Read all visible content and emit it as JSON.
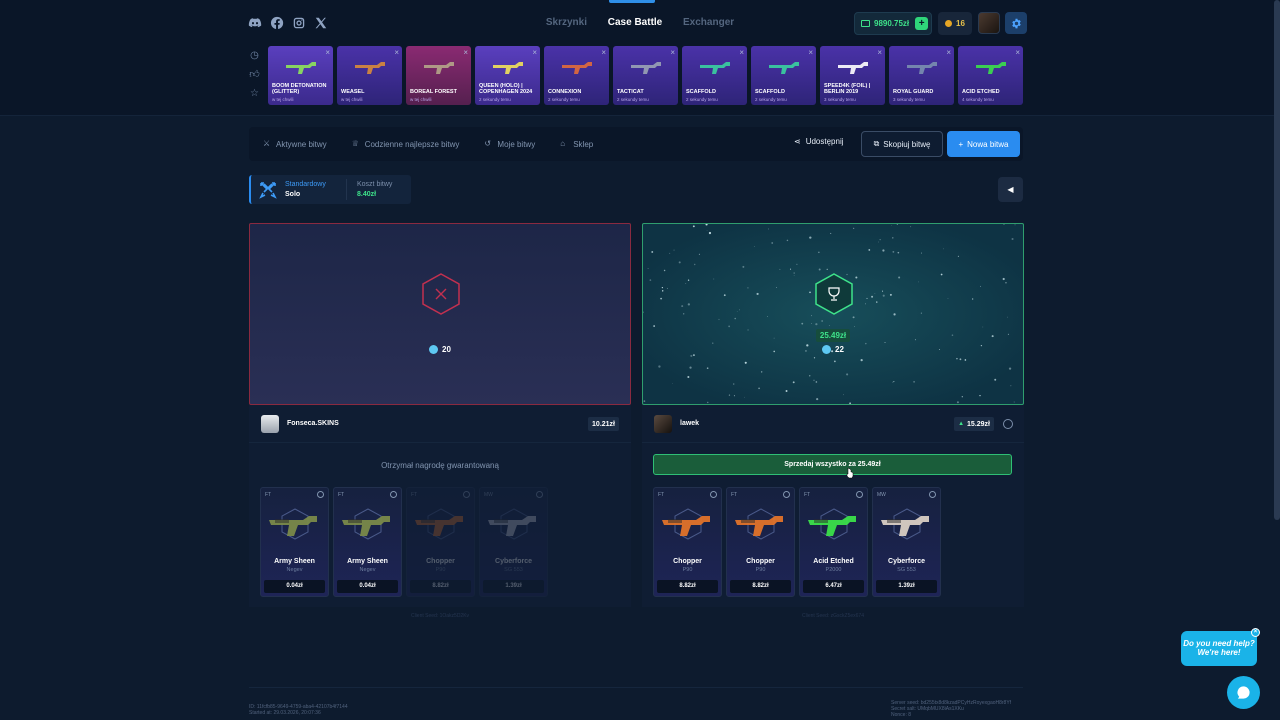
{
  "header": {
    "nav": [
      "Skrzynki",
      "Case Battle",
      "Exchanger"
    ],
    "active_nav": "Case Battle",
    "balance": "9890.75zł",
    "coins": "16",
    "socials": [
      "discord-icon",
      "facebook-icon",
      "instagram-icon",
      "x-icon"
    ]
  },
  "live_drops": [
    {
      "name": "BOOM DETONATION (GLITTER)",
      "time": "w tej chwili",
      "rarity": "gold",
      "color": "#8ee55a"
    },
    {
      "name": "WEASEL",
      "time": "w tej chwili",
      "rarity": "purple",
      "color": "#d98b3a"
    },
    {
      "name": "BOREAL FOREST",
      "time": "w tej chwili",
      "rarity": "pink",
      "color": "#b5a58a"
    },
    {
      "name": "QUEEN (HOLO) | COPENHAGEN 2024",
      "time": "2 sekundy temu",
      "rarity": "gold",
      "color": "#f2e25a"
    },
    {
      "name": "CONNEXION",
      "time": "2 sekundy temu",
      "rarity": "purple",
      "color": "#e26b3a"
    },
    {
      "name": "TACTICAT",
      "time": "2 sekundy temu",
      "rarity": "purple",
      "color": "#9aa3b5"
    },
    {
      "name": "SCAFFOLD",
      "time": "2 sekundy temu",
      "rarity": "purple",
      "color": "#3ad1a0"
    },
    {
      "name": "SCAFFOLD",
      "time": "2 sekundy temu",
      "rarity": "purple",
      "color": "#3ad1a0"
    },
    {
      "name": "SPEED4K (FOIL) | BERLIN 2019",
      "time": "3 sekundy temu",
      "rarity": "purple",
      "color": "#ffffff"
    },
    {
      "name": "ROYAL GUARD",
      "time": "3 sekundy temu",
      "rarity": "purple",
      "color": "#7a8fb0"
    },
    {
      "name": "ACID ETCHED",
      "time": "4 sekundy temu",
      "rarity": "purple",
      "color": "#3be04a"
    }
  ],
  "toolbar": {
    "tabs": [
      "Aktywne bitwy",
      "Codzienne najlepsze bitwy",
      "Moje bitwy",
      "Sklep"
    ],
    "share": "Udostępnij",
    "copy": "Skopiuj bitwę",
    "new": "Nowa bitwa"
  },
  "battle": {
    "mode_label": "Standardowy",
    "mode_value": "Solo",
    "cost_label": "Koszt bitwy",
    "cost_value": "8.40zł"
  },
  "players": [
    {
      "name": "Fonseca.SKINS",
      "total": "10.21zł",
      "count": "20",
      "result": "lose",
      "message": "Otrzymał nagrodę gwarantowaną",
      "seed": "Client Seed: 1Oakz5D2Kv",
      "items": [
        {
          "cond": "FT",
          "name": "Army Sheen",
          "weapon": "Negev",
          "price": "0.04zł",
          "faded": false,
          "color": "#7a8a4a"
        },
        {
          "cond": "FT",
          "name": "Army Sheen",
          "weapon": "Negev",
          "price": "0.04zł",
          "faded": false,
          "color": "#7a8a4a"
        },
        {
          "cond": "FT",
          "name": "Chopper",
          "weapon": "P90",
          "price": "8.82zł",
          "faded": true,
          "color": "#e0732a"
        },
        {
          "cond": "MW",
          "name": "Cyberforce",
          "weapon": "SG 553",
          "price": "1.39zł",
          "faded": true,
          "color": "#c9c9d6"
        }
      ]
    },
    {
      "name": "lawek",
      "total": "15.29zł",
      "count": "22",
      "win_amount": "25.49zł",
      "result": "win",
      "sell_label": "Sprzedaj wszystko za 25.49zł",
      "seed": "Client Seed: zGsckZ5ex674",
      "items": [
        {
          "cond": "FT",
          "name": "Chopper",
          "weapon": "P90",
          "price": "8.82zł",
          "faded": false,
          "color": "#e0732a"
        },
        {
          "cond": "FT",
          "name": "Chopper",
          "weapon": "P90",
          "price": "8.82zł",
          "faded": false,
          "color": "#e0732a"
        },
        {
          "cond": "FT",
          "name": "Acid Etched",
          "weapon": "P2000",
          "price": "6.47zł",
          "faded": false,
          "color": "#3be04a"
        },
        {
          "cond": "MW",
          "name": "Cyberforce",
          "weapon": "SG 553",
          "price": "1.39zł",
          "faded": false,
          "color": "#d9cfc4"
        }
      ]
    }
  ],
  "footer": {
    "id": "ID: 11fcfb85-9649-4759-aba4-42107b4f7144",
    "started": "Started at: 29.03.2026, 20:07:36",
    "server_seed": "Server seed: bd255tx8d8kzadPCyHzRoyexgaoH8r8Yf",
    "secret_salt": "Secret salt: UMqbMUX8iAs1XKu",
    "nonce": "Nonce: 8"
  },
  "help": {
    "bubble": "Do you need help? We're here!"
  }
}
